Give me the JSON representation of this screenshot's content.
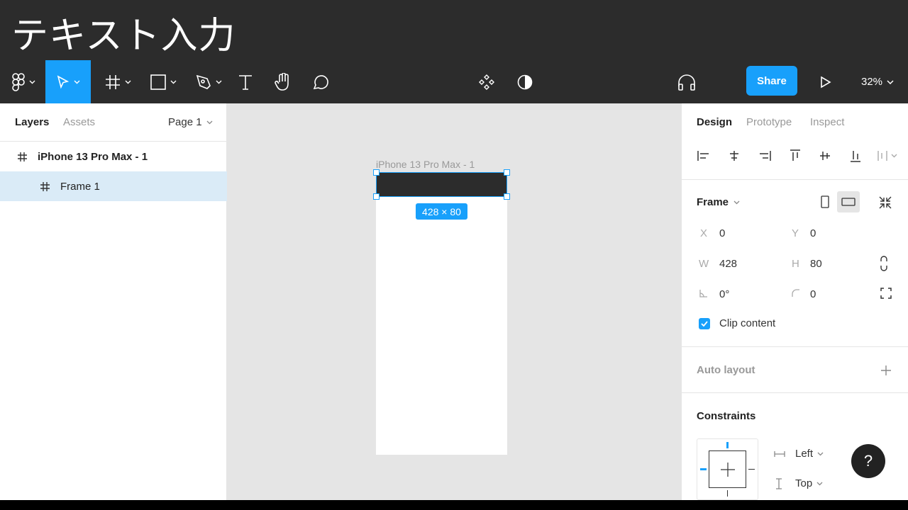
{
  "window": {
    "title": "テキスト入力"
  },
  "toolbar": {
    "tools": [
      {
        "name": "main-menu",
        "icon": "figma-logo-icon"
      },
      {
        "name": "move-tool",
        "icon": "cursor-icon",
        "active": true
      },
      {
        "name": "frame-tool",
        "icon": "hash-icon"
      },
      {
        "name": "shape-tool",
        "icon": "rectangle-icon"
      },
      {
        "name": "pen-tool",
        "icon": "pen-icon"
      },
      {
        "name": "text-tool",
        "icon": "text-icon"
      },
      {
        "name": "hand-tool",
        "icon": "hand-icon"
      },
      {
        "name": "comment-tool",
        "icon": "comment-icon"
      }
    ],
    "share_label": "Share",
    "zoom": "32%"
  },
  "left_panel": {
    "tabs": {
      "layers": "Layers",
      "assets": "Assets"
    },
    "page": "Page 1",
    "layers": [
      {
        "name": "iPhone 13 Pro Max - 1",
        "bold": true,
        "selected": false
      },
      {
        "name": "Frame 1",
        "bold": false,
        "selected": true
      }
    ]
  },
  "canvas": {
    "frame_label": "iPhone 13 Pro Max - 1",
    "selection_size": "428 × 80"
  },
  "right_panel": {
    "tabs": {
      "design": "Design",
      "prototype": "Prototype",
      "inspect": "Inspect"
    },
    "frame_section": {
      "title": "Frame",
      "x_label": "X",
      "x": "0",
      "y_label": "Y",
      "y": "0",
      "w_label": "W",
      "w": "428",
      "h_label": "H",
      "h": "80",
      "rotation": "0°",
      "corner_radius": "0",
      "clip_content_label": "Clip content",
      "clip_content": true
    },
    "auto_layout": {
      "title": "Auto layout"
    },
    "constraints": {
      "title": "Constraints",
      "horizontal": "Left",
      "vertical": "Top"
    }
  },
  "help_label": "?",
  "colors": {
    "accent": "#18a0fb",
    "toolbar": "#2c2c2c",
    "canvas": "#e5e5e5"
  }
}
